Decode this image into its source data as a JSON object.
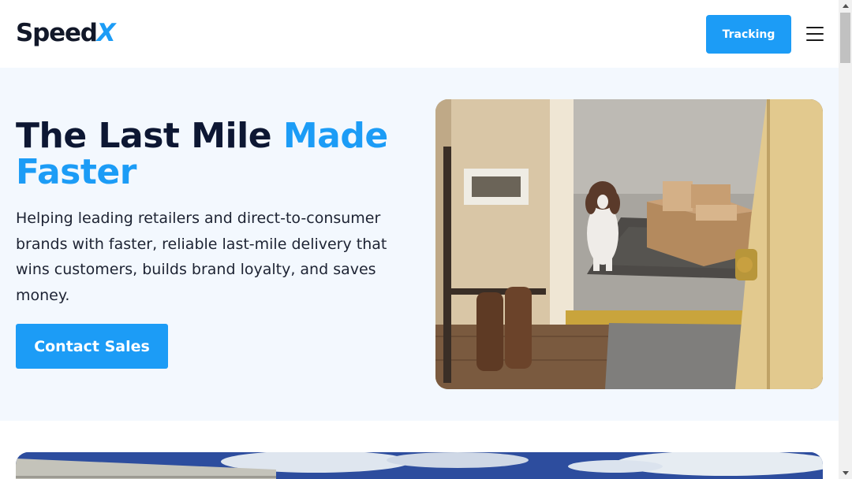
{
  "header": {
    "logo_text": "Speed",
    "logo_accent": "X",
    "tracking_label": "Tracking",
    "menu_icon": "hamburger-menu-icon"
  },
  "hero": {
    "title_part1": "The Last Mile ",
    "title_accent1": "Made",
    "title_accent2": "Faster",
    "description": "Helping leading retailers and direct-to-consumer brands with faster, reliable last-mile delivery that wins customers, builds brand loyalty, and saves money.",
    "cta_label": "Contact Sales",
    "image_subject": "dog on doormat beside delivered packages at open front door"
  },
  "colors": {
    "accent": "#1c9cf6",
    "heading": "#0d1733",
    "hero_bg": "#f3f8fe"
  }
}
